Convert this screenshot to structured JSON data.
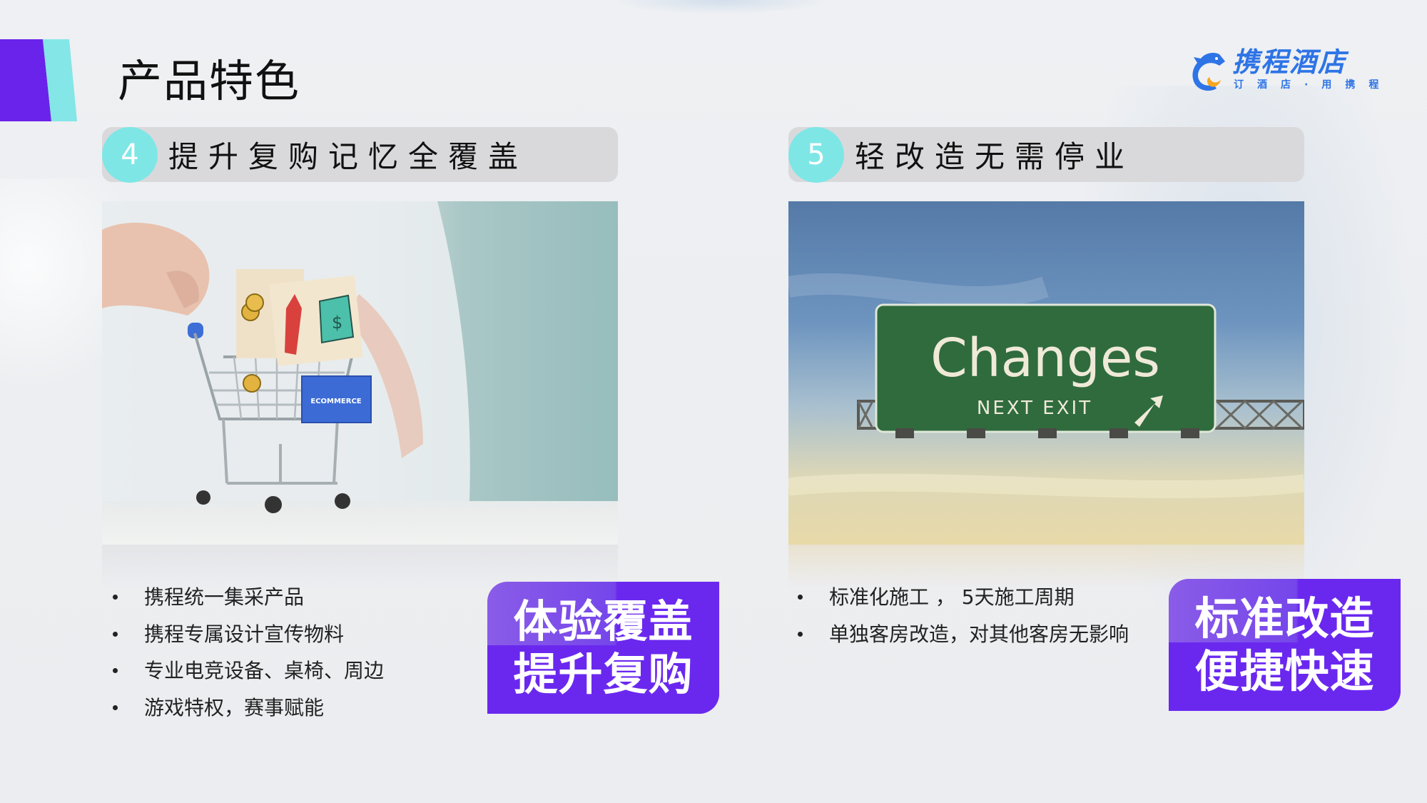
{
  "slide": {
    "title": "产品特色"
  },
  "logo": {
    "brand_name": "携程酒店",
    "slogan": "订酒店·用携程",
    "brand_color": "#2e74e6",
    "icon": "dolphin-logo-icon"
  },
  "colors": {
    "accent_purple": "#6a23ea",
    "accent_teal": "#84e6e6",
    "header_pill": "#d9d9db",
    "badge_purple": "#6a28ef"
  },
  "sections": [
    {
      "number": "4",
      "heading": "提升复购记忆全覆盖",
      "image": {
        "description": "hand pushing mini shopping cart with wooden blocks",
        "label_on_block": "ECOMMERCE"
      },
      "bullets": [
        "携程统一集采产品",
        "携程专属设计宣传物料",
        "专业电竞设备、桌椅、周边",
        "游戏特权，赛事赋能"
      ],
      "badge": [
        "体验覆盖",
        "提升复购"
      ]
    },
    {
      "number": "5",
      "heading": "轻改造无需停业",
      "image": {
        "description": "green highway sign against sky",
        "sign_title": "Changes",
        "sign_subtitle": "NEXT EXIT"
      },
      "bullets": [
        "标准化施工 ， 5天施工周期",
        "单独客房改造，对其他客房无影响"
      ],
      "badge": [
        "标准改造",
        "便捷快速"
      ]
    }
  ]
}
